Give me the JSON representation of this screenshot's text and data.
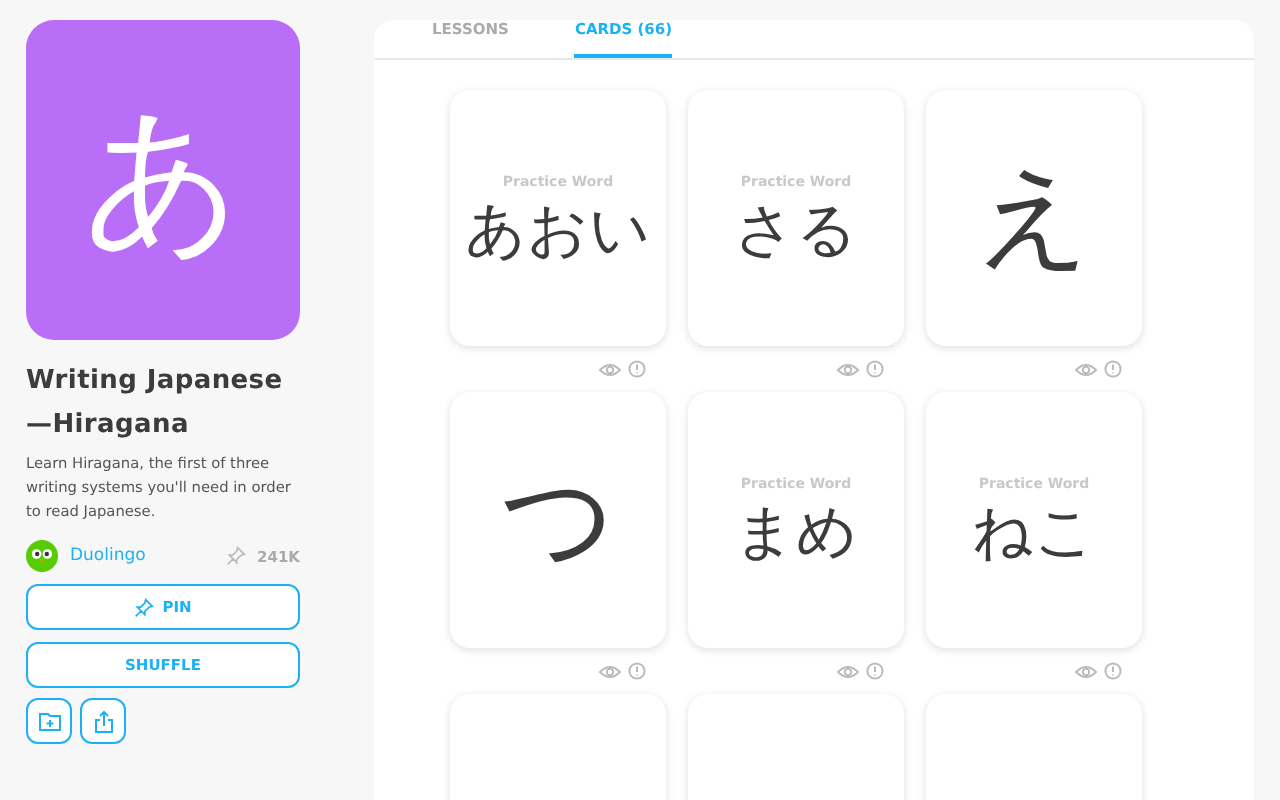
{
  "course": {
    "logo_char": "あ",
    "title": "Writing Japanese—Hiragana",
    "description": "Learn Hiragana, the first of three writing systems you'll need in order to read Japanese.",
    "author": "Duolingo",
    "pins": "241K"
  },
  "actions": {
    "pin": "PIN",
    "shuffle": "SHUFFLE"
  },
  "tabs": [
    {
      "label": "LESSONS",
      "selected": false
    },
    {
      "label": "CARDS (66)",
      "selected": true
    }
  ],
  "cards": [
    {
      "kind": "word",
      "label": "Practice Word",
      "text": "あおい"
    },
    {
      "kind": "word",
      "label": "Practice Word",
      "text": "さる"
    },
    {
      "kind": "letter",
      "text": "え"
    },
    {
      "kind": "letter",
      "text": "つ"
    },
    {
      "kind": "word",
      "label": "Practice Word",
      "text": "まめ"
    },
    {
      "kind": "word",
      "label": "Practice Word",
      "text": "ねこ"
    },
    {
      "kind": "cutoff"
    },
    {
      "kind": "cutoff"
    },
    {
      "kind": "cutoff"
    }
  ]
}
